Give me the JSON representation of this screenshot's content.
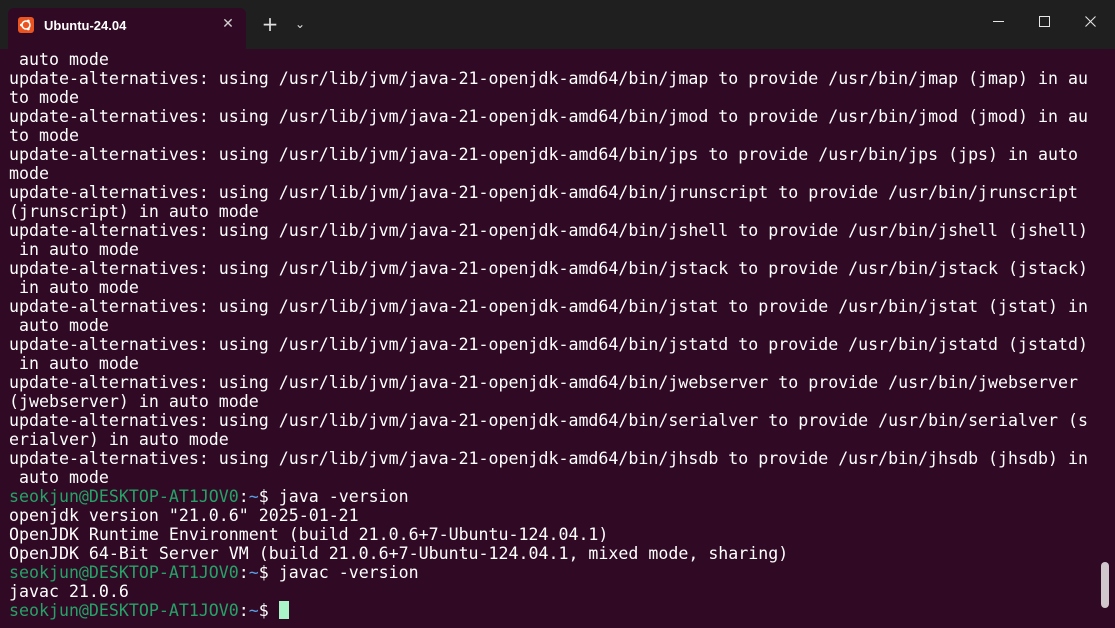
{
  "titlebar": {
    "tab_title": "Ubuntu-24.04",
    "tab_close_label": "✕",
    "new_tab_label": "+",
    "dropdown_label": "⌄"
  },
  "colors": {
    "terminal_bg": "#300a24",
    "titlebar_bg": "#1f1f1f",
    "accent": "#e95420",
    "prompt_user": "#26a269",
    "prompt_path": "#5aa0e6",
    "cursor": "#a9f5c8"
  },
  "icons": {
    "tab": "ubuntu-logo-icon",
    "minimize": "minimize-icon",
    "maximize": "maximize-icon",
    "close": "close-icon"
  },
  "terminal": {
    "output_lines": [
      " auto mode",
      "update-alternatives: using /usr/lib/jvm/java-21-openjdk-amd64/bin/jmap to provide /usr/bin/jmap (jmap) in au",
      "to mode",
      "update-alternatives: using /usr/lib/jvm/java-21-openjdk-amd64/bin/jmod to provide /usr/bin/jmod (jmod) in au",
      "to mode",
      "update-alternatives: using /usr/lib/jvm/java-21-openjdk-amd64/bin/jps to provide /usr/bin/jps (jps) in auto",
      "mode",
      "update-alternatives: using /usr/lib/jvm/java-21-openjdk-amd64/bin/jrunscript to provide /usr/bin/jrunscript",
      "(jrunscript) in auto mode",
      "update-alternatives: using /usr/lib/jvm/java-21-openjdk-amd64/bin/jshell to provide /usr/bin/jshell (jshell)",
      " in auto mode",
      "update-alternatives: using /usr/lib/jvm/java-21-openjdk-amd64/bin/jstack to provide /usr/bin/jstack (jstack)",
      " in auto mode",
      "update-alternatives: using /usr/lib/jvm/java-21-openjdk-amd64/bin/jstat to provide /usr/bin/jstat (jstat) in",
      " auto mode",
      "update-alternatives: using /usr/lib/jvm/java-21-openjdk-amd64/bin/jstatd to provide /usr/bin/jstatd (jstatd)",
      " in auto mode",
      "update-alternatives: using /usr/lib/jvm/java-21-openjdk-amd64/bin/jwebserver to provide /usr/bin/jwebserver",
      "(jwebserver) in auto mode",
      "update-alternatives: using /usr/lib/jvm/java-21-openjdk-amd64/bin/serialver to provide /usr/bin/serialver (s",
      "erialver) in auto mode",
      "update-alternatives: using /usr/lib/jvm/java-21-openjdk-amd64/bin/jhsdb to provide /usr/bin/jhsdb (jhsdb) in",
      " auto mode"
    ],
    "prompt": {
      "user_host": "seokjun@DESKTOP-AT1JOV0",
      "separator": ":",
      "path": "~",
      "symbol": "$ "
    },
    "command1": "java -version",
    "java_output": [
      "openjdk version \"21.0.6\" 2025-01-21",
      "OpenJDK Runtime Environment (build 21.0.6+7-Ubuntu-124.04.1)",
      "OpenJDK 64-Bit Server VM (build 21.0.6+7-Ubuntu-124.04.1, mixed mode, sharing)"
    ],
    "command2": "javac -version",
    "javac_output": "javac 21.0.6"
  }
}
